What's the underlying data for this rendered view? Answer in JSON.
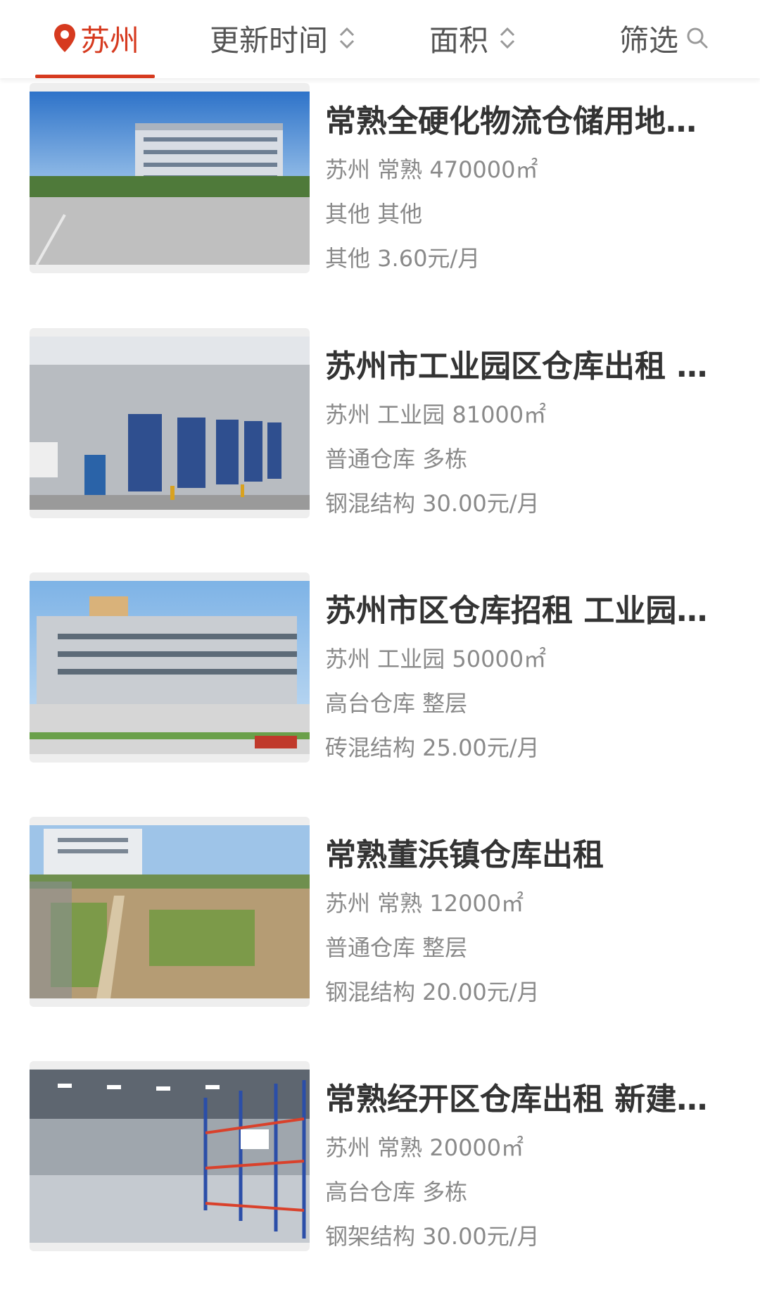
{
  "filter_bar": {
    "city": "苏州",
    "update_time": "更新时间",
    "area": "面积",
    "filter": "筛选"
  },
  "colors": {
    "accent": "#d63a1f",
    "title": "#333333",
    "meta": "#8a8a8a"
  },
  "listings": [
    {
      "title": "常熟全硬化物流仓储用地…",
      "location": "苏州 常熟 470000㎡",
      "type": "其他 其他",
      "price": "其他 3.60元/月"
    },
    {
      "title": "苏州市工业园区仓库出租 …",
      "location": "苏州 工业园 81000㎡",
      "type": "普通仓库 多栋",
      "price": "钢混结构 30.00元/月"
    },
    {
      "title": "苏州市区仓库招租 工业园…",
      "location": "苏州 工业园 50000㎡",
      "type": "高台仓库 整层",
      "price": "砖混结构 25.00元/月"
    },
    {
      "title": "常熟董浜镇仓库出租",
      "location": "苏州 常熟 12000㎡",
      "type": "普通仓库 整层",
      "price": "钢混结构 20.00元/月"
    },
    {
      "title": "常熟经开区仓库出租 新建…",
      "location": "苏州 常熟 20000㎡",
      "type": "高台仓库 多栋",
      "price": "钢架结构 30.00元/月"
    }
  ]
}
